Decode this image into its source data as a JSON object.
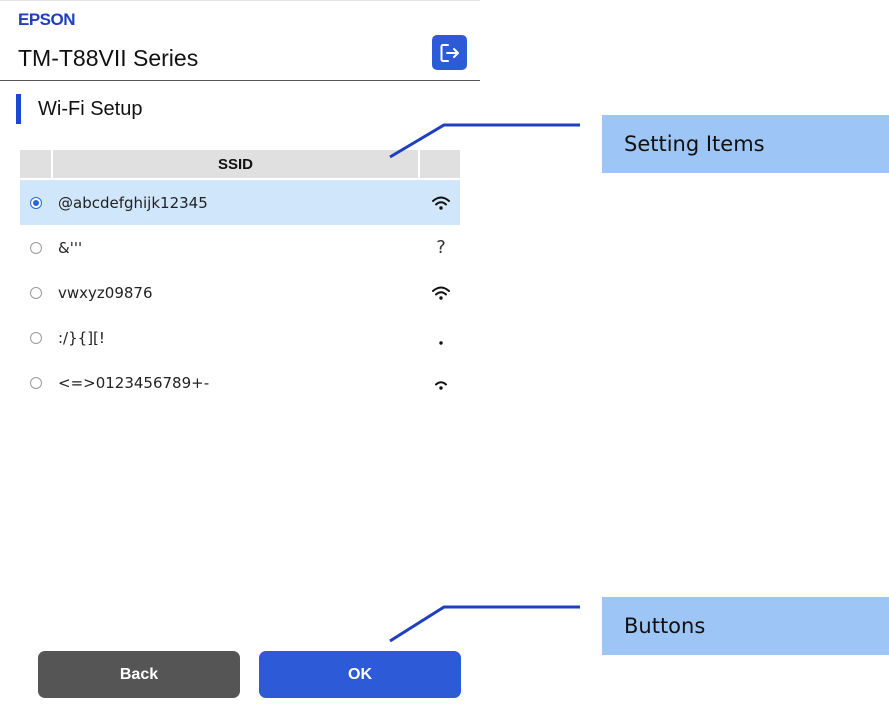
{
  "header": {
    "brand": "EPSON",
    "model": "TM-T88VII Series",
    "logout_icon": "logout-icon"
  },
  "section": {
    "title": "Wi-Fi Setup"
  },
  "table": {
    "columns": [
      "",
      "SSID",
      ""
    ],
    "rows": [
      {
        "ssid": "@abcdefghijk12345",
        "selected": true,
        "signal": "wifi-full"
      },
      {
        "ssid": "&'''",
        "selected": false,
        "signal": "unknown",
        "signal_text": "?"
      },
      {
        "ssid": "vwxyz09876",
        "selected": false,
        "signal": "wifi-full"
      },
      {
        "ssid": ":/}{][!",
        "selected": false,
        "signal": "wifi-dot"
      },
      {
        "ssid": "<=>0123456789+-",
        "selected": false,
        "signal": "wifi-low"
      }
    ]
  },
  "annotations": {
    "setting_items": "Setting Items",
    "buttons": "Buttons"
  },
  "buttons": {
    "back": "Back",
    "ok": "OK"
  },
  "colors": {
    "brand": "#1f3fbf",
    "primary": "#2d5ad6",
    "selected_row": "#cfe6fb",
    "callout": "#9dc5f5",
    "back_button": "#555555"
  }
}
